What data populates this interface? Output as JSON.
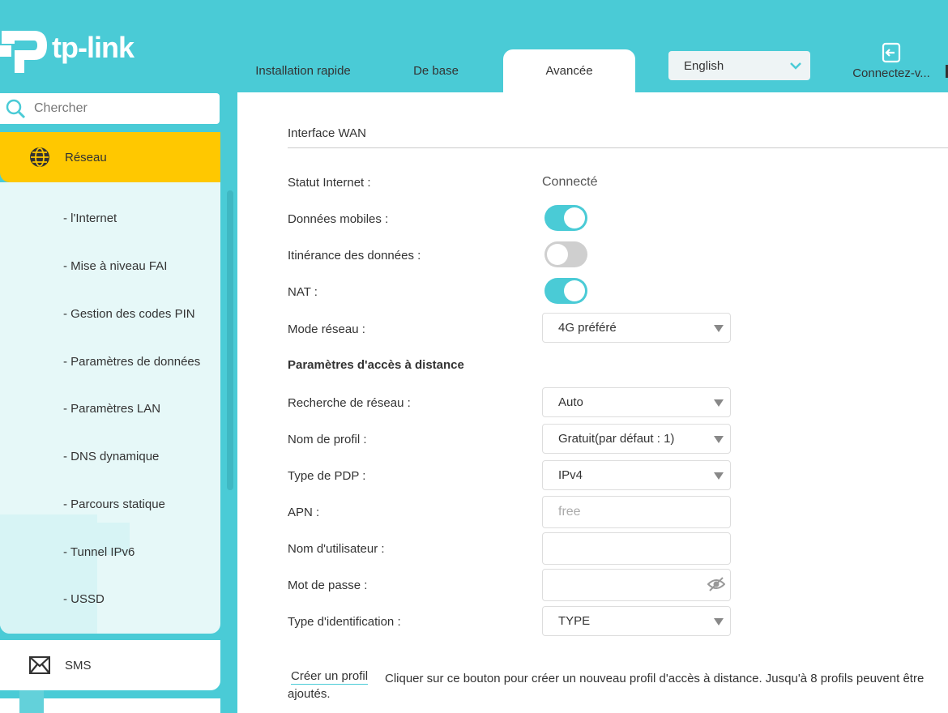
{
  "brand": {
    "name": "tp-link"
  },
  "header": {
    "tabs": [
      {
        "label": "Installation rapide",
        "active": false
      },
      {
        "label": "De base",
        "active": false
      },
      {
        "label": "Avancée",
        "active": true
      }
    ],
    "language": {
      "selected": "English"
    },
    "login": {
      "label": "Connectez-v..."
    }
  },
  "sidebar": {
    "search": {
      "placeholder": "Chercher"
    },
    "active_section": {
      "label": "Réseau",
      "icon": "globe-icon"
    },
    "items": [
      {
        "label": "- l'Internet"
      },
      {
        "label": "- Mise à niveau FAI"
      },
      {
        "label": "- Gestion des codes PIN"
      },
      {
        "label": "- Paramètres de données"
      },
      {
        "label": "- Paramètres LAN"
      },
      {
        "label": "- DNS dynamique"
      },
      {
        "label": "- Parcours statique"
      },
      {
        "label": "- Tunnel IPv6"
      },
      {
        "label": "- USSD"
      }
    ],
    "sms": {
      "label": "SMS",
      "icon": "envelope-icon"
    }
  },
  "main": {
    "section_title": "Interface WAN",
    "internet_status": {
      "label": "Statut Internet :",
      "value": "Connecté"
    },
    "mobile_data": {
      "label": "Données mobiles :",
      "on": true
    },
    "roaming": {
      "label": "Itinérance des données :",
      "on": false
    },
    "nat": {
      "label": "NAT :",
      "on": true
    },
    "network_mode": {
      "label": "Mode réseau :",
      "value": "4G préféré"
    },
    "remote_access_heading": "Paramètres d'accès à distance",
    "network_search": {
      "label": "Recherche de réseau :",
      "value": "Auto"
    },
    "profile_name": {
      "label": "Nom de profil :",
      "value": "Gratuit(par défaut : 1)"
    },
    "pdp_type": {
      "label": "Type de PDP :",
      "value": "IPv4"
    },
    "apn": {
      "label": "APN :",
      "placeholder": "free"
    },
    "username": {
      "label": "Nom d'utilisateur :",
      "value": ""
    },
    "password": {
      "label": "Mot de passe :",
      "value": ""
    },
    "auth_type": {
      "label": "Type d'identification :",
      "value": "TYPE"
    },
    "create_profile": {
      "link": "Créer un profil",
      "description": "Cliquer sur ce bouton pour créer un nouveau profil d'accès à distance. Jusqu'à 8 profils peuvent être ajoutés."
    }
  },
  "colors": {
    "accent": "#4acbd6",
    "active_nav": "#ffc800",
    "submenu_bg": "#e6f8f8"
  }
}
